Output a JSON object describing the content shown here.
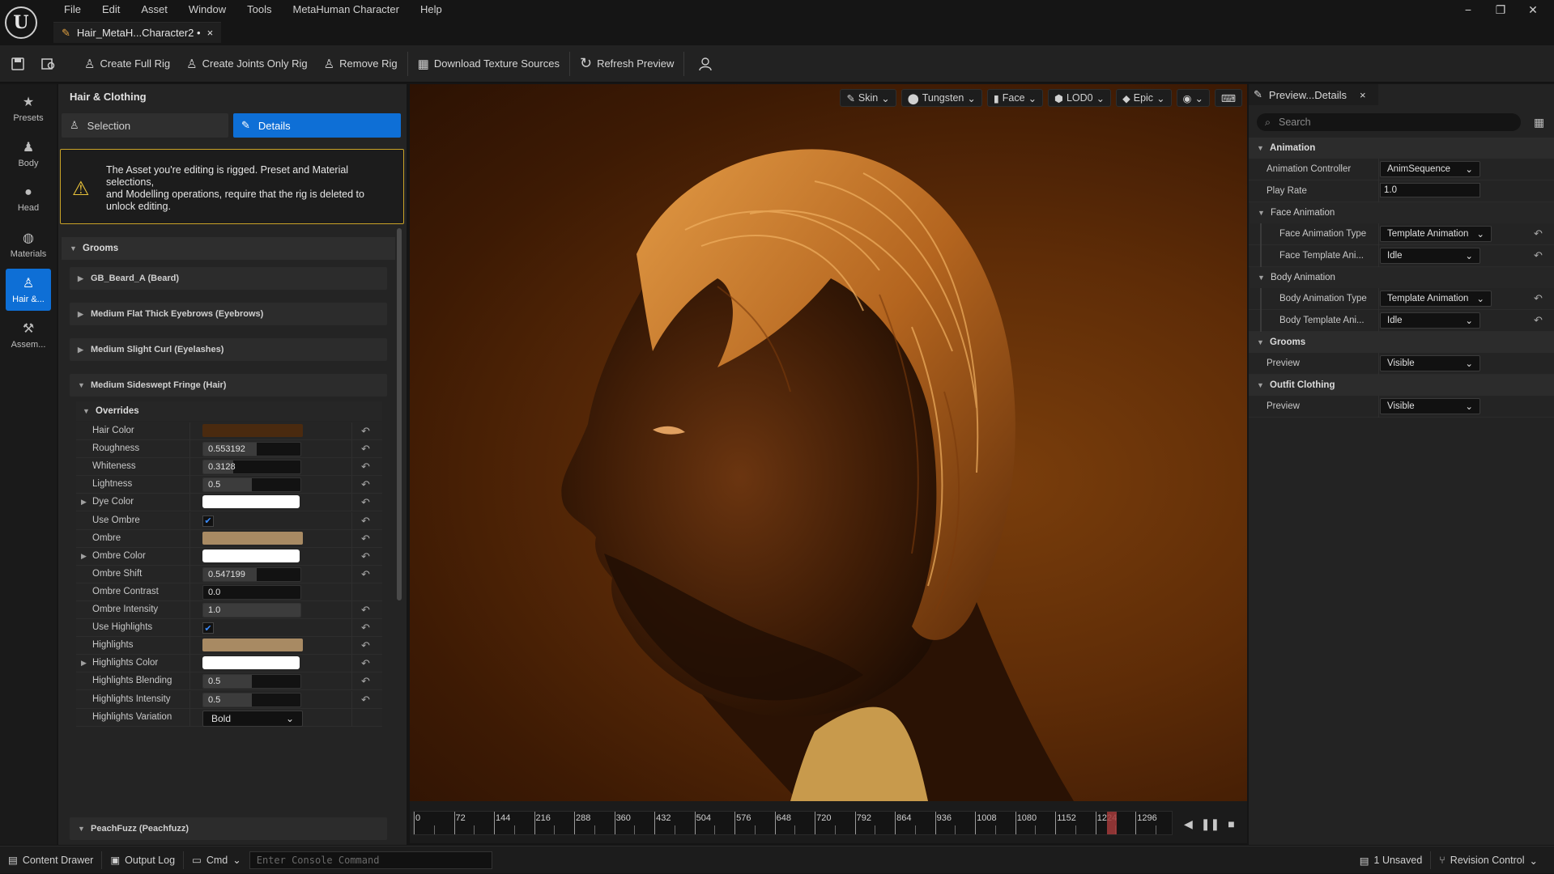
{
  "app": {
    "logo_text": "U",
    "menu": [
      "File",
      "Edit",
      "Asset",
      "Window",
      "Tools",
      "MetaHuman Character",
      "Help"
    ],
    "asset_tab": {
      "title": "Hair_MetaH...Character2 •",
      "close": "×"
    },
    "window_controls": {
      "minimize": "−",
      "restore": "❐",
      "close": "✕"
    }
  },
  "toolbar": {
    "save_icon": "save-icon",
    "browse_icon": "browse-icon",
    "buttons": [
      {
        "label": "Create Full Rig",
        "icon": "rig-icon"
      },
      {
        "label": "Create Joints Only Rig",
        "icon": "joints-icon"
      },
      {
        "label": "Remove Rig",
        "icon": "remove-rig-icon"
      },
      {
        "label": "Download Texture Sources",
        "icon": "download-texture-icon"
      },
      {
        "label": "Refresh Preview",
        "icon": "refresh-icon"
      }
    ],
    "user_icon": "user-icon"
  },
  "leftnav": {
    "items": [
      {
        "label": "Presets",
        "icon": "star-icon"
      },
      {
        "label": "Body",
        "icon": "body-icon"
      },
      {
        "label": "Head",
        "icon": "head-icon"
      },
      {
        "label": "Materials",
        "icon": "materials-icon"
      },
      {
        "label": "Hair &...",
        "icon": "hair-icon",
        "active": true
      },
      {
        "label": "Assem...",
        "icon": "hammer-icon"
      }
    ]
  },
  "leftpanel": {
    "title": "Hair & Clothing",
    "tabs": {
      "selection": "Selection",
      "details": "Details"
    },
    "warning": "The Asset you're editing is rigged. Preset and Material selections,\nand Modelling operations, require that the rig is deleted to unlock editing.",
    "grooms_header": "Grooms",
    "grooms": [
      "GB_Beard_A (Beard)",
      "Medium Flat Thick Eyebrows (Eyebrows)",
      "Medium Slight Curl (Eyelashes)",
      "Medium Sideswept Fringe (Hair)"
    ],
    "overrides_header": "Overrides",
    "properties": [
      {
        "label": "Hair Color",
        "type": "color",
        "color": "#4a2a0f"
      },
      {
        "label": "Roughness",
        "type": "number",
        "value": "0.553192",
        "fraction": 0.553
      },
      {
        "label": "Whiteness",
        "type": "number",
        "value": "0.3128",
        "fraction": 0.31
      },
      {
        "label": "Lightness",
        "type": "number",
        "value": "0.5",
        "fraction": 0.5
      },
      {
        "label": "Dye Color",
        "type": "white",
        "expandable": true
      },
      {
        "label": "Use Ombre",
        "type": "check",
        "checked": true
      },
      {
        "label": "Ombre",
        "type": "color",
        "color": "#a88a63"
      },
      {
        "label": "Ombre Color",
        "type": "white",
        "expandable": true
      },
      {
        "label": "Ombre Shift",
        "type": "number",
        "value": "0.547199",
        "fraction": 0.547
      },
      {
        "label": "Ombre Contrast",
        "type": "number",
        "value": "0.0",
        "fraction": 0.0,
        "noreset": true
      },
      {
        "label": "Ombre Intensity",
        "type": "number",
        "value": "1.0",
        "fraction": 1.0
      },
      {
        "label": "Use Highlights",
        "type": "check",
        "checked": true
      },
      {
        "label": "Highlights",
        "type": "color",
        "color": "#a88a63"
      },
      {
        "label": "Highlights Color",
        "type": "white",
        "expandable": true
      },
      {
        "label": "Highlights Blending",
        "type": "number",
        "value": "0.5",
        "fraction": 0.5
      },
      {
        "label": "Highlights Intensity",
        "type": "number",
        "value": "0.5",
        "fraction": 0.5
      },
      {
        "label": "Highlights Variation",
        "type": "dropdown",
        "value": "Bold",
        "noreset": true
      }
    ],
    "last_groom": "PeachFuzz (Peachfuzz)"
  },
  "viewport": {
    "toolbar": [
      {
        "label": "Skin",
        "icon": "brush-icon"
      },
      {
        "label": "Tungsten",
        "icon": "light-icon"
      },
      {
        "label": "Face",
        "icon": "camera-icon"
      },
      {
        "label": "LOD0",
        "icon": "lod-icon"
      },
      {
        "label": "Epic",
        "icon": "quality-icon"
      },
      {
        "label": "",
        "icon": "eye-icon"
      },
      {
        "label": "",
        "icon": "keyboard-icon"
      }
    ]
  },
  "timeline": {
    "labels": [
      "0",
      "72",
      "144",
      "216",
      "288",
      "360",
      "432",
      "504",
      "576",
      "648",
      "720",
      "792",
      "864",
      "936",
      "1008",
      "1080",
      "1152",
      "1224",
      "1296"
    ],
    "playhead_frame": 1224,
    "transport": {
      "back": "◀",
      "pause": "❚❚",
      "stop": "■"
    }
  },
  "rightpanel": {
    "tab": "Preview...Details",
    "search_placeholder": "Search",
    "sections": {
      "animation": "Animation",
      "face_animation": "Face Animation",
      "body_animation": "Body Animation",
      "grooms": "Grooms",
      "outfit": "Outfit Clothing"
    },
    "rows": {
      "anim_controller": {
        "label": "Animation Controller",
        "value": "AnimSequence"
      },
      "play_rate": {
        "label": "Play Rate",
        "value": "1.0"
      },
      "face_anim_type": {
        "label": "Face Animation Type",
        "value": "Template Animation"
      },
      "face_template": {
        "label": "Face Template Ani...",
        "value": "Idle"
      },
      "body_anim_type": {
        "label": "Body Animation Type",
        "value": "Template Animation"
      },
      "body_template": {
        "label": "Body Template Ani...",
        "value": "Idle"
      },
      "grooms_preview": {
        "label": "Preview",
        "value": "Visible"
      },
      "outfit_preview": {
        "label": "Preview",
        "value": "Visible"
      }
    }
  },
  "statusbar": {
    "content_drawer": "Content Drawer",
    "output_log": "Output Log",
    "cmd": "Cmd",
    "console_placeholder": "Enter Console Command",
    "unsaved": "1 Unsaved",
    "revision_control": "Revision Control"
  }
}
